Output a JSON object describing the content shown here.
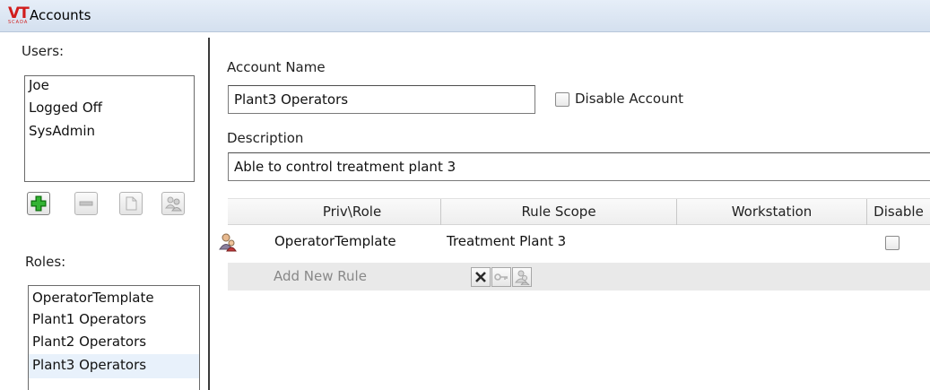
{
  "window": {
    "title": "Accounts",
    "logo_text": "VT",
    "logo_subtext": "SCADA"
  },
  "left": {
    "users_label": "Users:",
    "users": [
      "Joe",
      "Logged Off",
      "SysAdmin"
    ],
    "roles_label": "Roles:",
    "roles": [
      "OperatorTemplate",
      "Plant1 Operators",
      "Plant2 Operators",
      "Plant3 Operators"
    ],
    "selected_role": "Plant3 Operators",
    "toolbar": [
      "add-icon",
      "remove-icon",
      "copy-icon",
      "users-icon"
    ]
  },
  "account": {
    "name_label": "Account Name",
    "name_value": "Plant3 Operators",
    "disable_label": "Disable Account",
    "description_label": "Description",
    "description_value": "Able to control treatment plant 3"
  },
  "grid": {
    "columns": [
      "Priv\\Role",
      "Rule Scope",
      "Workstation",
      "Disable"
    ],
    "rows": [
      {
        "icon": "role-icon",
        "priv_role": "OperatorTemplate",
        "rule_scope": "Treatment Plant 3",
        "workstation": "",
        "disable": false
      }
    ],
    "add_rule_label": "Add New Rule",
    "add_rule_buttons": [
      "delete-icon",
      "key-icon",
      "role-icon"
    ]
  },
  "colors": {
    "accent_green": "#1f9a1f",
    "logo_red": "#d11c1c",
    "selection": "#e8f1fb"
  }
}
